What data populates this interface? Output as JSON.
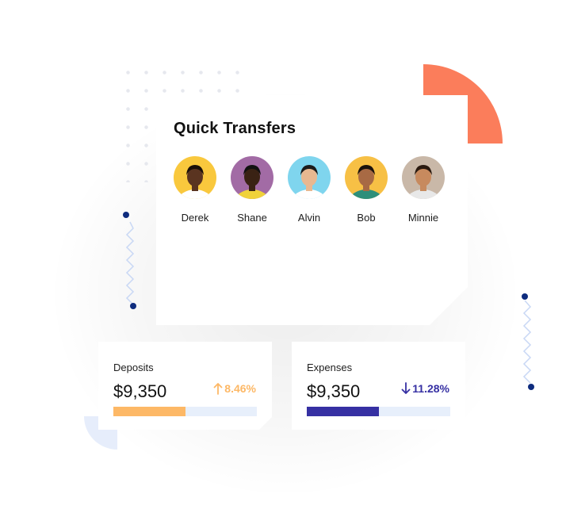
{
  "quick_transfers": {
    "title": "Quick Transfers",
    "contacts": [
      {
        "name": "Derek",
        "avatar": "avatar-woman-yellow-bg",
        "bg": "#f9c83d"
      },
      {
        "name": "Shane",
        "avatar": "avatar-woman-purple-bg",
        "bg": "#a26ba5"
      },
      {
        "name": "Alvin",
        "avatar": "avatar-man-cyan-bg",
        "bg": "#7fd5ee"
      },
      {
        "name": "Bob",
        "avatar": "avatar-man-yellow-bg",
        "bg": "#f7c045"
      },
      {
        "name": "Minnie",
        "avatar": "avatar-man-beige-bg",
        "bg": "#c9b8a8"
      }
    ]
  },
  "deposits": {
    "label": "Deposits",
    "value": "$9,350",
    "change": "8.46%",
    "direction": "up",
    "progress": 0.5,
    "color": "#fdb866"
  },
  "expenses": {
    "label": "Expenses",
    "value": "$9,350",
    "change": "11.28%",
    "direction": "down",
    "progress": 0.5,
    "color": "#3630a3"
  },
  "colors": {
    "accent_orange": "#fb7d5b",
    "light_blue": "#e7effb",
    "navy": "#0e2c7e"
  }
}
